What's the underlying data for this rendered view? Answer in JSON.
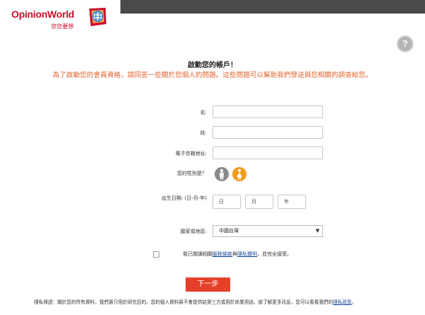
{
  "logo": {
    "name_part1": "Opinion",
    "name_part2": "World",
    "tagline": "您您要想"
  },
  "help": {
    "label": "?"
  },
  "heading": {
    "title": "啟動您的帳戶！",
    "subtitle": "為了啟動您的會員資格，請回答一些關於您個人的問題。這些問題可以幫助我們發送與您相關的調查給您。"
  },
  "form": {
    "first_name_label": "名:",
    "last_name_label": "姓:",
    "email_label": "電子信箱地址:",
    "gender_label": "您的性別是？",
    "dob_label": "出生日期: (日-月-年)",
    "day_placeholder": "日",
    "month_placeholder": "月",
    "year_placeholder": "年",
    "country_label": "國家或地區:",
    "country_value": "中國台灣",
    "first_name_value": "",
    "last_name_value": "",
    "email_value": ""
  },
  "agreement": {
    "prefix": "我已閱讀相關",
    "terms_link": "服務條款",
    "and": "與",
    "privacy_link": "隱私聲明",
    "suffix": "，並完全接受。"
  },
  "next_button": "下一步",
  "footer": {
    "privacy_text": "隱私保證：關於您的所有資料，我們將只用於研究目的。您的個人資料將不會提供給第三方或用於商業用途。欲了解更多訊息，您可以看看我們的",
    "privacy_link": "隱私政策",
    "end": "。"
  },
  "colors": {
    "accent": "#e0612a",
    "button": "#e5402a",
    "logo_red": "#c8102e",
    "link": "#1a4a9b"
  }
}
